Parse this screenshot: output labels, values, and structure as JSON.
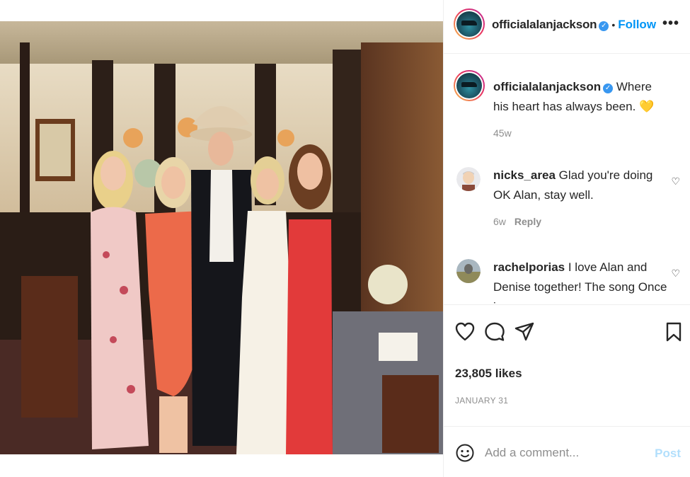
{
  "post": {
    "username": "officialalanjackson",
    "follow_label": "Follow",
    "more_label": "•••",
    "caption": {
      "username": "officialalanjackson",
      "text": "Where his heart has always been.",
      "emoji": "💛",
      "time": "45w"
    },
    "comments": [
      {
        "username": "nicks_area",
        "text": "Glad you're doing OK Alan, stay well.",
        "time": "6w",
        "reply_label": "Reply"
      },
      {
        "username": "rachelporias",
        "text": "I love Alan and Denise together! The song Once in a",
        "time": "",
        "reply_label": ""
      }
    ],
    "likes": "23,805 likes",
    "date": "JANUARY 31",
    "add_comment_placeholder": "Add a comment...",
    "post_label": "Post"
  },
  "icons": {
    "verified": "verified-badge-icon",
    "like": "heart-icon",
    "comment": "comment-bubble-icon",
    "share": "paper-plane-icon",
    "save": "bookmark-icon",
    "emoji": "smiley-icon"
  },
  "colors": {
    "follow": "#0095f6",
    "verified": "#3897f0",
    "post_disabled": "#b2dffc",
    "muted": "#8e8e8e"
  }
}
